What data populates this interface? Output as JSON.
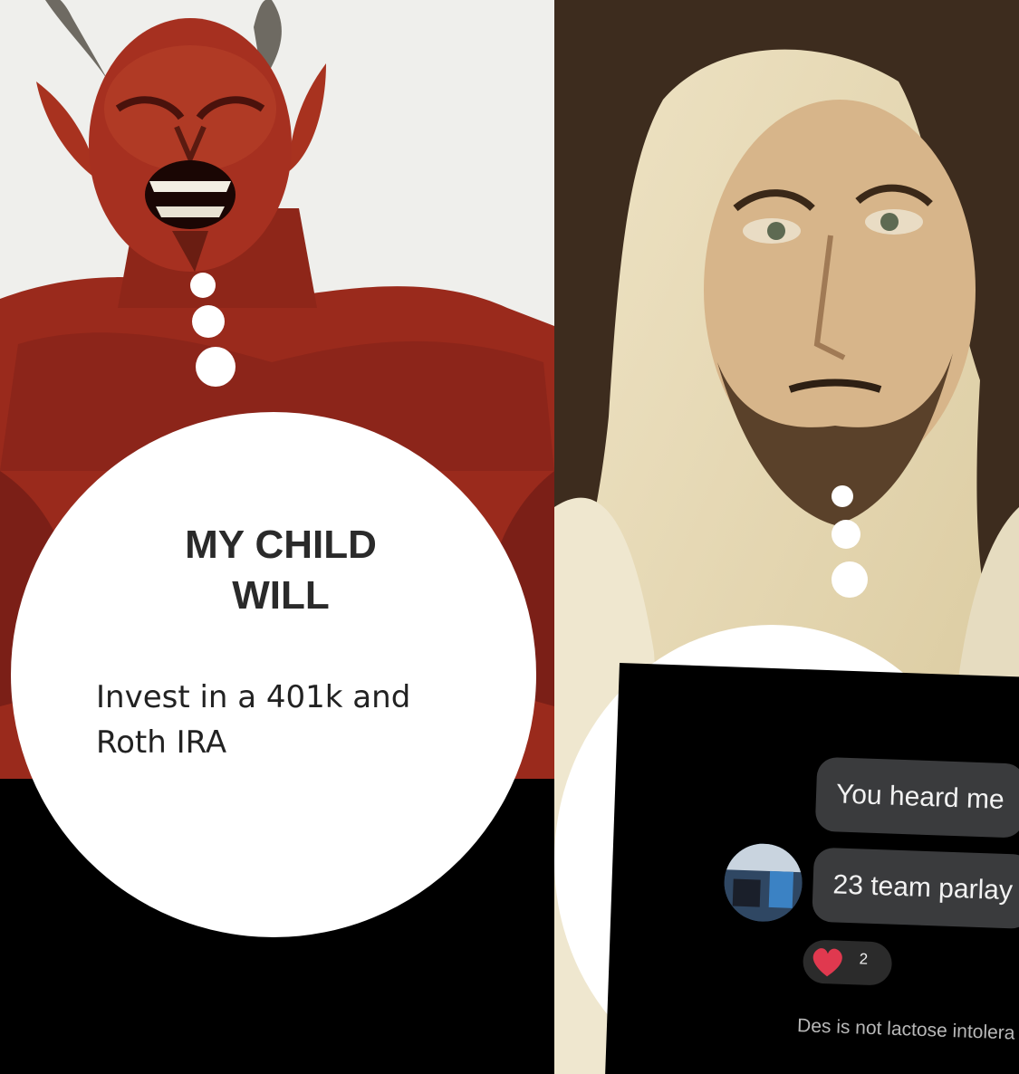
{
  "left_panel": {
    "caption_title_line1": "MY CHILD",
    "caption_title_line2": "WILL",
    "caption_body_line1": "Invest in a 401k and",
    "caption_body_line2": "Roth IRA"
  },
  "right_panel": {
    "chat": {
      "messages": [
        {
          "text": "You heard me"
        },
        {
          "text": "23 team parlay"
        }
      ],
      "reaction_count": "2",
      "sender_name": "Des is not lactose intolera"
    }
  },
  "colors": {
    "devil_red": "#9a2a1c",
    "chat_bubble": "#3a3b3d",
    "heart": "#e0394f"
  }
}
